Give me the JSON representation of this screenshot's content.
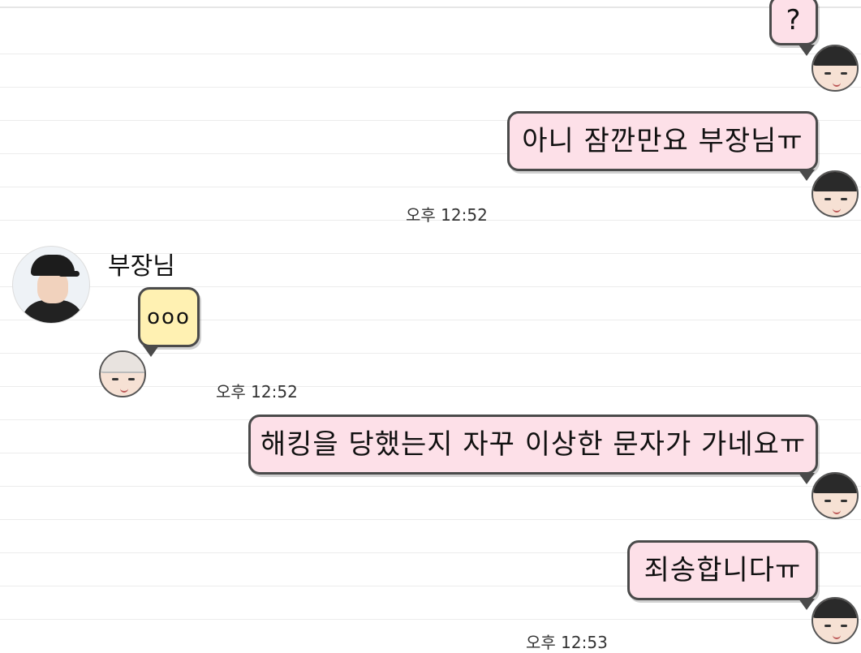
{
  "messages": {
    "m0": {
      "text": "?"
    },
    "m1": {
      "text": "아니 잠깐만요 부장님ㅠ"
    },
    "m2": {
      "sender": "부장님",
      "text": "ooo"
    },
    "m3": {
      "text": "해킹을 당했는지 자꾸 이상한 문자가 가네요ㅠ"
    },
    "m4": {
      "text": "죄송합니다ㅠ"
    }
  },
  "timestamps": {
    "t1": "오후 12:52",
    "t2": "오후 12:52",
    "t3": "오후 12:53"
  },
  "colors": {
    "sent_bubble": "#fde0e8",
    "received_bubble": "#fff1b2",
    "bubble_border": "#4a4a4a"
  },
  "icons": {
    "sender_avatar": "profile-photo-avatar",
    "self_sticker": "dark-hair-face-sticker",
    "other_sticker": "light-hair-face-sticker"
  }
}
